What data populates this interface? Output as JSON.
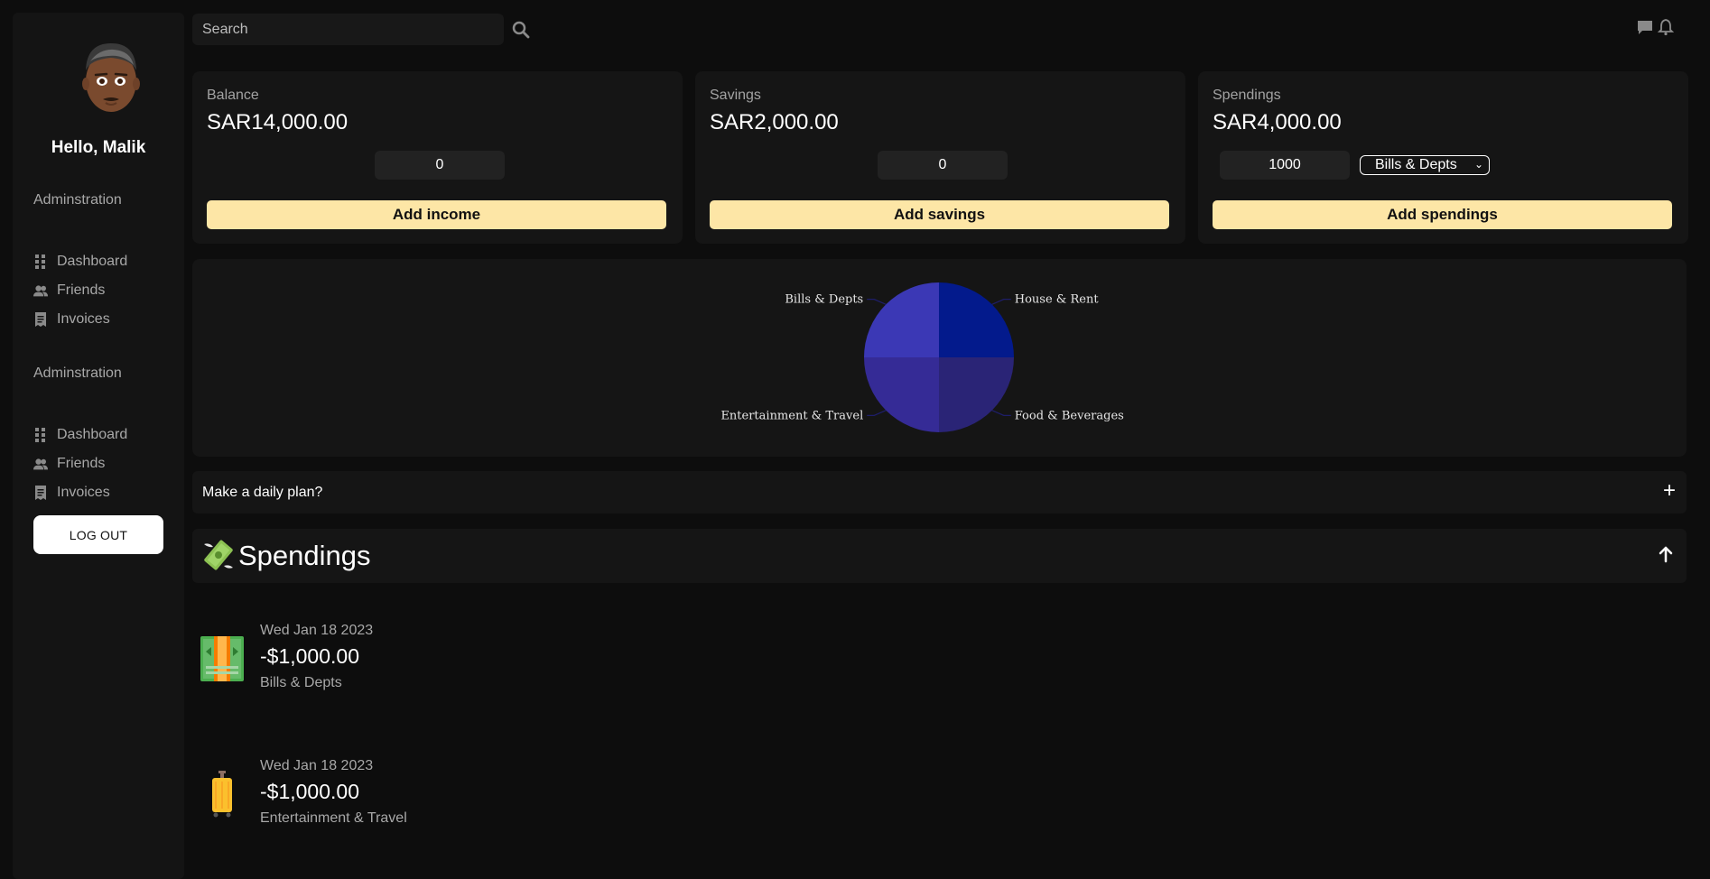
{
  "sidebar": {
    "greeting": "Hello, Malik",
    "sections": [
      {
        "heading": "Adminstration",
        "items": [
          {
            "label": "Dashboard",
            "icon": "grid-icon"
          },
          {
            "label": "Friends",
            "icon": "users-icon"
          },
          {
            "label": "Invoices",
            "icon": "receipt-icon"
          }
        ]
      },
      {
        "heading": "Adminstration",
        "items": [
          {
            "label": "Dashboard",
            "icon": "grid-icon"
          },
          {
            "label": "Friends",
            "icon": "users-icon"
          },
          {
            "label": "Invoices",
            "icon": "receipt-icon"
          }
        ]
      }
    ],
    "logout_label": "LOG OUT"
  },
  "topbar": {
    "search_placeholder": "Search",
    "icons": [
      "search-icon",
      "chat-icon",
      "bell-icon"
    ]
  },
  "cards": {
    "balance": {
      "label": "Balance",
      "amount": "SAR14,000.00",
      "input_value": "0",
      "action": "Add income"
    },
    "savings": {
      "label": "Savings",
      "amount": "SAR2,000.00",
      "input_value": "0",
      "action": "Add savings"
    },
    "spendings": {
      "label": "Spendings",
      "amount": "SAR4,000.00",
      "input_value": "1000",
      "category_selected": "Bills & Depts",
      "action": "Add spendings"
    }
  },
  "chart_data": {
    "type": "pie",
    "categories": [
      "House & Rent",
      "Food & Beverages",
      "Entertainment & Travel",
      "Bills & Depts"
    ],
    "values": [
      1,
      1,
      1,
      1
    ],
    "colors": [
      "#031a8c",
      "#2a2476",
      "#352b96",
      "#3b38b5"
    ],
    "legend": "none"
  },
  "plan": {
    "label": "Make a daily plan?",
    "toggle": "+"
  },
  "spendings_section": {
    "title": "Spendings",
    "transactions": [
      {
        "date": "Wed Jan 18 2023",
        "amount": "-$1,000.00",
        "category": "Bills & Depts",
        "icon": "money-icon"
      },
      {
        "date": "Wed Jan 18 2023",
        "amount": "-$1,000.00",
        "category": "Entertainment & Travel",
        "icon": "luggage-icon"
      }
    ]
  },
  "colors": {
    "background": "#0d0d0d",
    "panel": "#151515",
    "accent_button": "#fde6a6"
  }
}
